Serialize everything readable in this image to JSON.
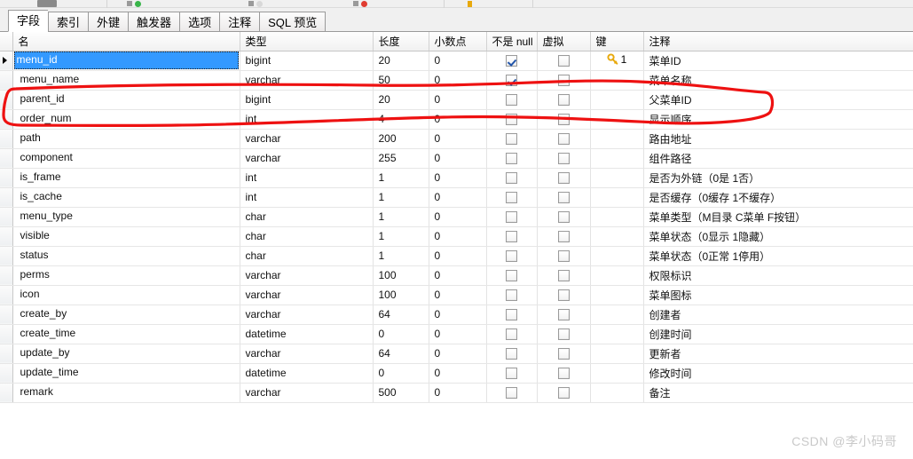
{
  "toolbar": {
    "icons": [
      "save-icon",
      "add-row-icon",
      "insert-icon",
      "delete-icon",
      "primary-key-icon"
    ]
  },
  "tabs": [
    {
      "label": "字段",
      "active": true,
      "name": "tab-fields"
    },
    {
      "label": "索引",
      "active": false,
      "name": "tab-indexes"
    },
    {
      "label": "外键",
      "active": false,
      "name": "tab-foreign-keys"
    },
    {
      "label": "触发器",
      "active": false,
      "name": "tab-triggers"
    },
    {
      "label": "选项",
      "active": false,
      "name": "tab-options"
    },
    {
      "label": "注释",
      "active": false,
      "name": "tab-comment"
    },
    {
      "label": "SQL 预览",
      "active": false,
      "name": "tab-sql-preview"
    }
  ],
  "grid": {
    "columns": [
      {
        "key": "sel",
        "label": ""
      },
      {
        "key": "name",
        "label": "名"
      },
      {
        "key": "type",
        "label": "类型"
      },
      {
        "key": "len",
        "label": "长度"
      },
      {
        "key": "dec",
        "label": "小数点"
      },
      {
        "key": "null",
        "label": "不是 null"
      },
      {
        "key": "virt",
        "label": "虚拟"
      },
      {
        "key": "key",
        "label": "键"
      },
      {
        "key": "cmt",
        "label": "注释"
      }
    ],
    "rows": [
      {
        "name": "menu_id",
        "type": "bigint",
        "len": "20",
        "dec": "0",
        "notnull": true,
        "virtual": false,
        "key": "1",
        "comment": "菜单ID",
        "selected": true
      },
      {
        "name": "menu_name",
        "type": "varchar",
        "len": "50",
        "dec": "0",
        "notnull": true,
        "virtual": false,
        "key": "",
        "comment": "菜单名称",
        "selected": false
      },
      {
        "name": "parent_id",
        "type": "bigint",
        "len": "20",
        "dec": "0",
        "notnull": false,
        "virtual": false,
        "key": "",
        "comment": "父菜单ID",
        "selected": false
      },
      {
        "name": "order_num",
        "type": "int",
        "len": "4",
        "dec": "0",
        "notnull": false,
        "virtual": false,
        "key": "",
        "comment": "显示顺序",
        "selected": false
      },
      {
        "name": "path",
        "type": "varchar",
        "len": "200",
        "dec": "0",
        "notnull": false,
        "virtual": false,
        "key": "",
        "comment": "路由地址",
        "selected": false
      },
      {
        "name": "component",
        "type": "varchar",
        "len": "255",
        "dec": "0",
        "notnull": false,
        "virtual": false,
        "key": "",
        "comment": "组件路径",
        "selected": false
      },
      {
        "name": "is_frame",
        "type": "int",
        "len": "1",
        "dec": "0",
        "notnull": false,
        "virtual": false,
        "key": "",
        "comment": "是否为外链（0是 1否）",
        "selected": false
      },
      {
        "name": "is_cache",
        "type": "int",
        "len": "1",
        "dec": "0",
        "notnull": false,
        "virtual": false,
        "key": "",
        "comment": "是否缓存（0缓存 1不缓存）",
        "selected": false
      },
      {
        "name": "menu_type",
        "type": "char",
        "len": "1",
        "dec": "0",
        "notnull": false,
        "virtual": false,
        "key": "",
        "comment": "菜单类型（M目录 C菜单 F按钮）",
        "selected": false
      },
      {
        "name": "visible",
        "type": "char",
        "len": "1",
        "dec": "0",
        "notnull": false,
        "virtual": false,
        "key": "",
        "comment": "菜单状态（0显示 1隐藏）",
        "selected": false
      },
      {
        "name": "status",
        "type": "char",
        "len": "1",
        "dec": "0",
        "notnull": false,
        "virtual": false,
        "key": "",
        "comment": "菜单状态（0正常 1停用）",
        "selected": false
      },
      {
        "name": "perms",
        "type": "varchar",
        "len": "100",
        "dec": "0",
        "notnull": false,
        "virtual": false,
        "key": "",
        "comment": "权限标识",
        "selected": false
      },
      {
        "name": "icon",
        "type": "varchar",
        "len": "100",
        "dec": "0",
        "notnull": false,
        "virtual": false,
        "key": "",
        "comment": "菜单图标",
        "selected": false
      },
      {
        "name": "create_by",
        "type": "varchar",
        "len": "64",
        "dec": "0",
        "notnull": false,
        "virtual": false,
        "key": "",
        "comment": "创建者",
        "selected": false
      },
      {
        "name": "create_time",
        "type": "datetime",
        "len": "0",
        "dec": "0",
        "notnull": false,
        "virtual": false,
        "key": "",
        "comment": "创建时间",
        "selected": false
      },
      {
        "name": "update_by",
        "type": "varchar",
        "len": "64",
        "dec": "0",
        "notnull": false,
        "virtual": false,
        "key": "",
        "comment": "更新者",
        "selected": false
      },
      {
        "name": "update_time",
        "type": "datetime",
        "len": "0",
        "dec": "0",
        "notnull": false,
        "virtual": false,
        "key": "",
        "comment": "修改时间",
        "selected": false
      },
      {
        "name": "remark",
        "type": "varchar",
        "len": "500",
        "dec": "0",
        "notnull": false,
        "virtual": false,
        "key": "",
        "comment": "备注",
        "selected": false
      }
    ]
  },
  "annotation": {
    "type": "hand-drawn-ellipse",
    "color": "#ee1111",
    "target_row": "parent_id"
  },
  "watermark": {
    "text": "CSDN @李小码哥"
  },
  "colors": {
    "selection": "#3399ff",
    "annotation": "#ee1111",
    "key_icon": "#e8a90c",
    "checkbox_check": "#2255aa",
    "watermark": "#c9c9c9"
  }
}
